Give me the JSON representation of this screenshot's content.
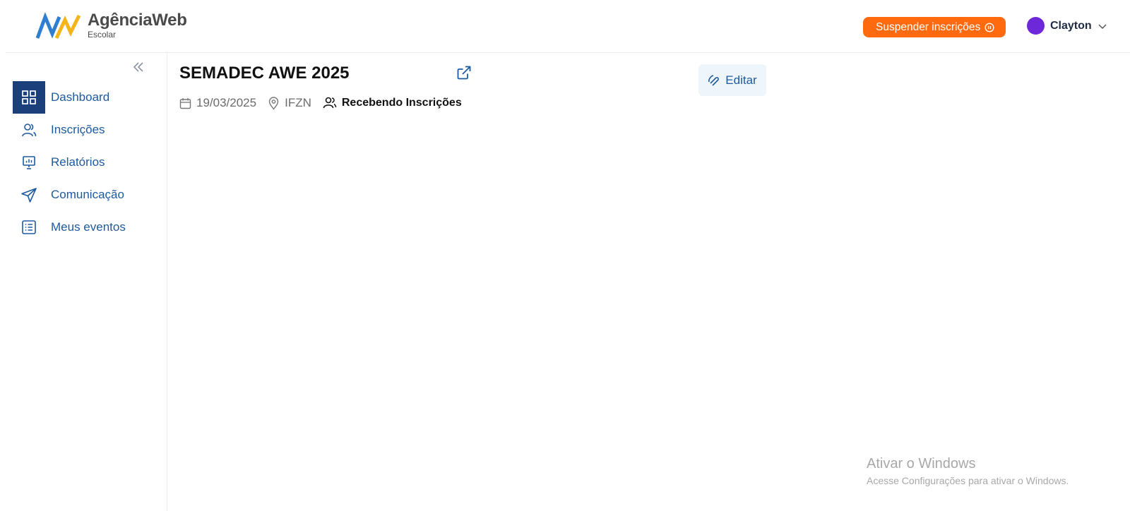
{
  "brand": {
    "name": "AgênciaWeb",
    "subtitle": "Escolar",
    "logo_icon": "agencia-web-logo"
  },
  "header": {
    "suspend_label": "Suspender inscrições",
    "suspend_color": "#ff6a0e",
    "user_name": "Clayton",
    "avatar_color": "#6d28d9"
  },
  "sidebar": {
    "active_color": "#1b3f7a",
    "items": [
      {
        "label": "Dashboard",
        "icon": "grid-icon",
        "active": true
      },
      {
        "label": "Inscrições",
        "icon": "users-icon",
        "active": false
      },
      {
        "label": "Relatórios",
        "icon": "presentation-chart-icon",
        "active": false
      },
      {
        "label": "Comunicação",
        "icon": "send-icon",
        "active": false
      },
      {
        "label": "Meus eventos",
        "icon": "list-icon",
        "active": false
      }
    ]
  },
  "event": {
    "title": "SEMADEC AWE 2025",
    "date": "19/03/2025",
    "location": "IFZN",
    "status": "Recebendo Inscrições",
    "edit_label": "Editar"
  },
  "watermark": {
    "title": "Ativar o Windows",
    "subtitle": "Acesse Configurações para ativar o Windows."
  }
}
